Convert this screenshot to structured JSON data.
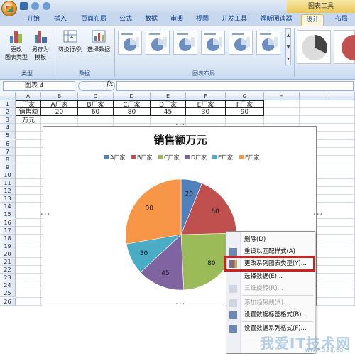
{
  "ribbon": {
    "contextual_label": "图表工具",
    "tabs": [
      "开始",
      "插入",
      "页面布局",
      "公式",
      "数据",
      "审阅",
      "视图",
      "开发工具",
      "福昕阅读器",
      "设计",
      "布局"
    ],
    "active_tab": "设计",
    "groups": {
      "type": {
        "label": "类型",
        "change_chart_type": "更改\n图表类型",
        "save_as_template": "另存为\n模板"
      },
      "data": {
        "label": "数据",
        "switch_row_col": "切换行/列",
        "select_data": "选择数据"
      },
      "layout": {
        "label": "图表布局"
      }
    }
  },
  "formula_bar": {
    "name_box": "图表 4",
    "fx": "fx",
    "value": ""
  },
  "columns": [
    "A",
    "B",
    "C",
    "D",
    "E",
    "F",
    "G",
    "H",
    "I"
  ],
  "rows": [
    "1",
    "2",
    "3",
    "4",
    "5",
    "6",
    "7",
    "8",
    "9",
    "10",
    "11",
    "12",
    "13",
    "14",
    "15",
    "16",
    "17",
    "18",
    "19",
    "20",
    "21",
    "22",
    "23",
    "24",
    "25",
    "26"
  ],
  "table": {
    "header": [
      "厂家",
      "A厂家",
      "B厂家",
      "C厂家",
      "D厂家",
      "E厂家",
      "F厂家"
    ],
    "row": [
      "销售额万元",
      "20",
      "60",
      "80",
      "45",
      "30",
      "90"
    ]
  },
  "chart_data": {
    "type": "pie",
    "title": "销售额万元",
    "categories": [
      "A厂家",
      "B厂家",
      "C厂家",
      "D厂家",
      "E厂家",
      "F厂家"
    ],
    "values": [
      20,
      60,
      80,
      45,
      30,
      90
    ],
    "colors": [
      "#4f81bd",
      "#c0504d",
      "#9bbb59",
      "#8064a2",
      "#4bacc6",
      "#f79646"
    ],
    "legend": "top",
    "data_labels": true
  },
  "context_menu": {
    "items": [
      {
        "label": "删除(D)",
        "enabled": true
      },
      {
        "label": "重设以匹配样式(A)",
        "enabled": true
      },
      {
        "label": "更改系列图表类型(Y)...",
        "enabled": true,
        "highlighted": true
      },
      {
        "label": "选择数据(E)...",
        "enabled": true
      },
      {
        "label": "三维旋转(R)...",
        "enabled": false
      },
      {
        "label": "添加趋势线(R)...",
        "enabled": false
      },
      {
        "label": "设置数据标签格式(B)...",
        "enabled": true
      },
      {
        "label": "设置数据系列格式(F)...",
        "enabled": true
      }
    ]
  },
  "watermark": {
    "text": "我爱IT技术网",
    "sub": "www.52ij.com"
  }
}
